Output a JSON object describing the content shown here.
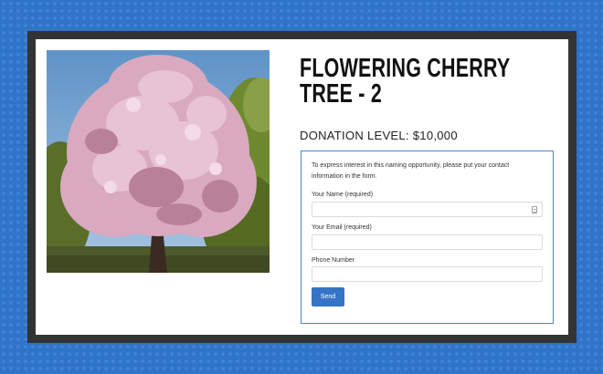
{
  "product": {
    "title": "FLOWERING CHERRY TREE - 2",
    "donation_level": "DONATION LEVEL: $10,000"
  },
  "form": {
    "intro": "To express interest in this naming opportunity, please put your contact information in the form.",
    "name_label": "Your Name (required)",
    "name_value": "",
    "email_label": "Your Email (required)",
    "email_value": "",
    "phone_label": "Phone Number",
    "phone_value": "",
    "send_label": "Send"
  },
  "colors": {
    "background": "#2f74c9",
    "frame": "#333333",
    "form_border": "#4a86cf",
    "button": "#3674c6"
  },
  "icons": {
    "name_field_icon": "keyboard-icon"
  }
}
